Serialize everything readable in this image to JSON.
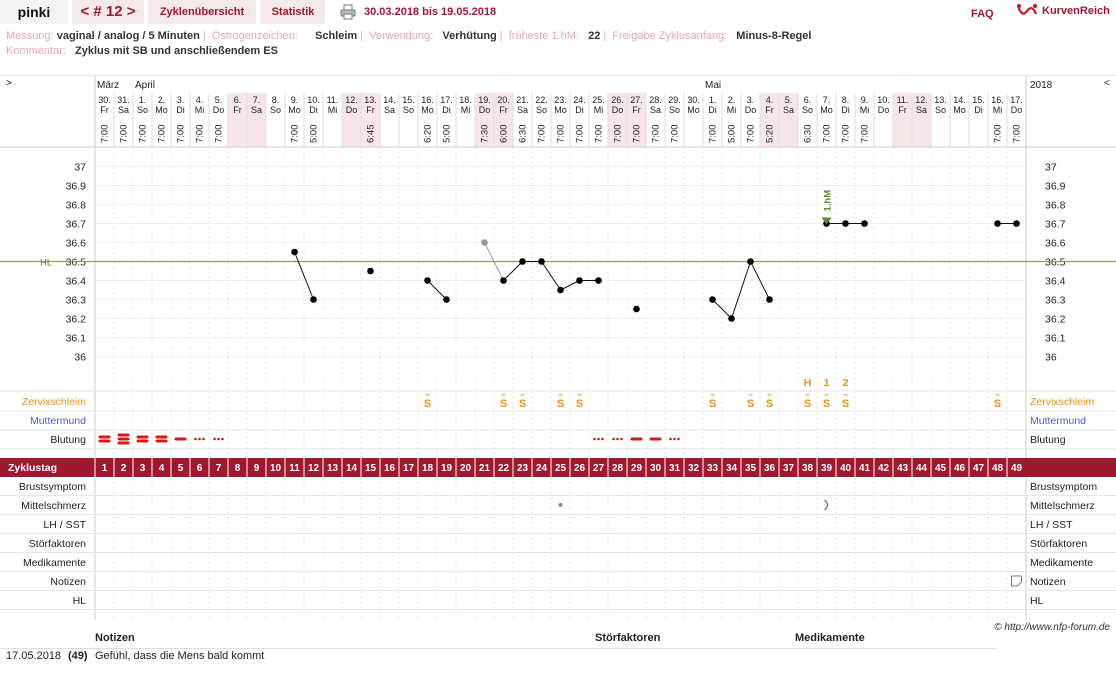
{
  "topbar": {
    "user": "pinki",
    "cycle": "< # 12 >",
    "overview": "Zyklenübersicht",
    "stats": "Statistik",
    "range": "30.03.2018 bis 19.05.2018",
    "faq": "FAQ",
    "brand": "KurvenReich",
    "printer_icon": "printer-icon"
  },
  "meta": {
    "messung_label": "Messung:",
    "messung_value": "vaginal / analog / 5 Minuten",
    "oestrogen_label": "Östrogenzeichen:",
    "oestrogen_value": "Schleim",
    "verwendung_label": "Verwendung:",
    "verwendung_value": "Verhütung",
    "hm_label": "früheste 1.hM:",
    "hm_value": "22",
    "freigabe_label": "Freigabe Zyklusanfang:",
    "freigabe_value": "Minus-8-Regel",
    "kommentar_label": "Kommentar:",
    "kommentar_value": "Zyklus mit SB und anschließendem ES"
  },
  "chart_data": {
    "type": "line",
    "year": "2018",
    "months": [
      {
        "label": "März",
        "col": 1
      },
      {
        "label": "April",
        "col": 3
      },
      {
        "label": "Mai",
        "col": 33
      }
    ],
    "days": [
      {
        "d": "30.",
        "w": "Fr",
        "t": "7:00"
      },
      {
        "d": "31.",
        "w": "Sa",
        "t": "7:00"
      },
      {
        "d": "1.",
        "w": "So",
        "t": "7:00"
      },
      {
        "d": "2.",
        "w": "Mo",
        "t": "7:00"
      },
      {
        "d": "3.",
        "w": "Di",
        "t": "7:00"
      },
      {
        "d": "4.",
        "w": "Mi",
        "t": "7:00"
      },
      {
        "d": "5.",
        "w": "Do",
        "t": "7:00"
      },
      {
        "d": "6.",
        "w": "Fr",
        "t": ""
      },
      {
        "d": "7.",
        "w": "Sa",
        "t": ""
      },
      {
        "d": "8.",
        "w": "So",
        "t": ""
      },
      {
        "d": "9.",
        "w": "Mo",
        "t": "7:00"
      },
      {
        "d": "10.",
        "w": "Di",
        "t": "5:00"
      },
      {
        "d": "11.",
        "w": "Mi",
        "t": ""
      },
      {
        "d": "12.",
        "w": "Do",
        "t": ""
      },
      {
        "d": "13.",
        "w": "Fr",
        "t": "6:45"
      },
      {
        "d": "14.",
        "w": "Sa",
        "t": ""
      },
      {
        "d": "15.",
        "w": "So",
        "t": ""
      },
      {
        "d": "16.",
        "w": "Mo",
        "t": "6:20"
      },
      {
        "d": "17.",
        "w": "Di",
        "t": "5:00"
      },
      {
        "d": "18.",
        "w": "Mi",
        "t": ""
      },
      {
        "d": "19.",
        "w": "Do",
        "t": "7:30"
      },
      {
        "d": "20.",
        "w": "Fr",
        "t": "6:00"
      },
      {
        "d": "21.",
        "w": "Sa",
        "t": "6:30"
      },
      {
        "d": "22.",
        "w": "So",
        "t": "7:00"
      },
      {
        "d": "23.",
        "w": "Mo",
        "t": "7:00"
      },
      {
        "d": "24.",
        "w": "Di",
        "t": "7:00"
      },
      {
        "d": "25.",
        "w": "Mi",
        "t": "7:00"
      },
      {
        "d": "26.",
        "w": "Do",
        "t": "7:00"
      },
      {
        "d": "27.",
        "w": "Fr",
        "t": "7:00"
      },
      {
        "d": "28.",
        "w": "Sa",
        "t": "7:00"
      },
      {
        "d": "29.",
        "w": "So",
        "t": "7:00"
      },
      {
        "d": "30.",
        "w": "Mo",
        "t": ""
      },
      {
        "d": "1.",
        "w": "Di",
        "t": "7:00"
      },
      {
        "d": "2.",
        "w": "Mi",
        "t": "5:00"
      },
      {
        "d": "3.",
        "w": "Do",
        "t": "7:00"
      },
      {
        "d": "4.",
        "w": "Fr",
        "t": "5:20"
      },
      {
        "d": "5.",
        "w": "Sa",
        "t": ""
      },
      {
        "d": "6.",
        "w": "So",
        "t": "6:30"
      },
      {
        "d": "7.",
        "w": "Mo",
        "t": "7:00"
      },
      {
        "d": "8.",
        "w": "Di",
        "t": "7:00"
      },
      {
        "d": "9.",
        "w": "Mi",
        "t": "7:00"
      },
      {
        "d": "10.",
        "w": "Do",
        "t": ""
      },
      {
        "d": "11.",
        "w": "Fr",
        "t": ""
      },
      {
        "d": "12.",
        "w": "Sa",
        "t": ""
      },
      {
        "d": "13.",
        "w": "So",
        "t": ""
      },
      {
        "d": "14.",
        "w": "Mo",
        "t": ""
      },
      {
        "d": "15.",
        "w": "Di",
        "t": ""
      },
      {
        "d": "16.",
        "w": "Mi",
        "t": "7:00"
      },
      {
        "d": "17.",
        "w": "Do",
        "t": "7:00"
      }
    ],
    "weekend_cols": [
      8,
      9,
      14,
      15,
      21,
      22,
      28,
      29,
      36,
      37,
      43,
      44
    ],
    "yticks": [
      "37",
      "36.9",
      "36.8",
      "36.7",
      "36.6",
      "36.5",
      "36.4",
      "36.3",
      "36.2",
      "36.1",
      "36"
    ],
    "ylim": [
      36.0,
      37.0
    ],
    "hl_label": "HL",
    "hl_value": 36.5,
    "temps": [
      {
        "c": 11,
        "v": 36.55
      },
      {
        "c": 12,
        "v": 36.3
      },
      {
        "c": 15,
        "v": 36.45
      },
      {
        "c": 18,
        "v": 36.4
      },
      {
        "c": 19,
        "v": 36.3
      },
      {
        "c": 21,
        "v": 36.6,
        "excluded": true
      },
      {
        "c": 22,
        "v": 36.4
      },
      {
        "c": 23,
        "v": 36.5
      },
      {
        "c": 24,
        "v": 36.5
      },
      {
        "c": 25,
        "v": 36.35
      },
      {
        "c": 26,
        "v": 36.4
      },
      {
        "c": 27,
        "v": 36.4
      },
      {
        "c": 29,
        "v": 36.25
      },
      {
        "c": 33,
        "v": 36.3
      },
      {
        "c": 34,
        "v": 36.2
      },
      {
        "c": 35,
        "v": 36.5
      },
      {
        "c": 36,
        "v": 36.3
      },
      {
        "c": 39,
        "v": 36.7
      },
      {
        "c": 40,
        "v": 36.7
      },
      {
        "c": 41,
        "v": 36.7
      },
      {
        "c": 48,
        "v": 36.7
      },
      {
        "c": 49,
        "v": 36.7
      }
    ],
    "hm_marker": {
      "c": 39,
      "label": "1.hM"
    },
    "peak_marks": [
      {
        "c": 38,
        "t": "H"
      },
      {
        "c": 39,
        "t": "1"
      },
      {
        "c": 40,
        "t": "2"
      }
    ],
    "mucus": [
      18,
      22,
      23,
      25,
      26,
      33,
      35,
      36,
      38,
      39,
      40,
      48
    ],
    "mucus_symbol": "S",
    "bleeding": [
      {
        "c": 1,
        "k": "heavy"
      },
      {
        "c": 2,
        "k": "vheavy"
      },
      {
        "c": 3,
        "k": "heavy"
      },
      {
        "c": 4,
        "k": "heavy"
      },
      {
        "c": 5,
        "k": "normal"
      },
      {
        "c": 6,
        "k": "dots"
      },
      {
        "c": 7,
        "k": "dots"
      },
      {
        "c": 27,
        "k": "dots"
      },
      {
        "c": 28,
        "k": "dots"
      },
      {
        "c": 29,
        "k": "normal"
      },
      {
        "c": 30,
        "k": "normal"
      },
      {
        "c": 31,
        "k": "dots"
      }
    ],
    "row_labels_left": {
      "zervix": "Zervixschleim",
      "muttermund": "Muttermund",
      "blutung": "Blutung",
      "zyklustag": "Zyklustag",
      "brust": "Brustsymptom",
      "mittel": "Mittelschmerz",
      "lh": "LH / SST",
      "stoer": "Störfaktoren",
      "medi": "Medikamente",
      "notizen": "Notizen",
      "hl": "HL"
    },
    "mittel_marks": [
      {
        "c": 25,
        "k": "dot"
      },
      {
        "c": 39,
        "k": "paren"
      }
    ],
    "notes_icon_col": 49,
    "corner_left": ">",
    "corner_right": "<",
    "colors": {
      "accent": "#a01830",
      "hl_line": "#8aa05a",
      "weekend": "#f6e6ea",
      "orange": "#e8901a",
      "blue": "#4a5fc8",
      "green": "#5c8a3a"
    }
  },
  "footer": {
    "copyright": "© http://www.nfp-forum.de",
    "headers": {
      "notizen": "Notizen",
      "stoer": "Störfaktoren",
      "medi": "Medikamente"
    },
    "rows": [
      {
        "date": "17.05.2018",
        "day": "(49)",
        "text": "Gefühl, dass die Mens bald kommt"
      }
    ]
  }
}
